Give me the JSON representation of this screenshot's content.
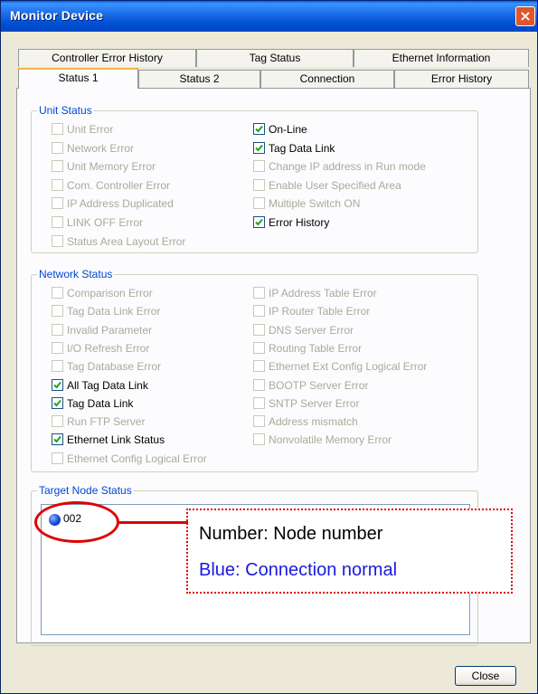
{
  "window": {
    "title": "Monitor Device",
    "close_glyph": "×"
  },
  "tabs_back": [
    "Controller Error History",
    "Tag Status",
    "Ethernet Information"
  ],
  "tabs_front": [
    "Status 1",
    "Status 2",
    "Connection",
    "Error History"
  ],
  "active_tab": "Status 1",
  "unit_status": {
    "label": "Unit Status",
    "left": [
      {
        "label": "Unit Error",
        "checked": false,
        "enabled": false
      },
      {
        "label": "Network Error",
        "checked": false,
        "enabled": false
      },
      {
        "label": "Unit Memory Error",
        "checked": false,
        "enabled": false
      },
      {
        "label": "Com. Controller Error",
        "checked": false,
        "enabled": false
      },
      {
        "label": "IP Address Duplicated",
        "checked": false,
        "enabled": false
      },
      {
        "label": "LINK OFF Error",
        "checked": false,
        "enabled": false
      },
      {
        "label": "Status Area Layout Error",
        "checked": false,
        "enabled": false
      }
    ],
    "right": [
      {
        "label": "On-Line",
        "checked": true,
        "enabled": true
      },
      {
        "label": "Tag Data Link",
        "checked": true,
        "enabled": true
      },
      {
        "label": "Change IP address in Run mode",
        "checked": false,
        "enabled": false
      },
      {
        "label": "Enable User Specified Area",
        "checked": false,
        "enabled": false
      },
      {
        "label": "Multiple Switch ON",
        "checked": false,
        "enabled": false
      },
      {
        "label": "Error History",
        "checked": true,
        "enabled": true
      }
    ]
  },
  "network_status": {
    "label": "Network Status",
    "left": [
      {
        "label": "Comparison Error",
        "checked": false,
        "enabled": false
      },
      {
        "label": "Tag Data Link Error",
        "checked": false,
        "enabled": false
      },
      {
        "label": "Invalid Parameter",
        "checked": false,
        "enabled": false
      },
      {
        "label": "I/O Refresh Error",
        "checked": false,
        "enabled": false
      },
      {
        "label": "Tag Database Error",
        "checked": false,
        "enabled": false
      },
      {
        "label": "All Tag Data Link",
        "checked": true,
        "enabled": true
      },
      {
        "label": "Tag Data Link",
        "checked": true,
        "enabled": true
      },
      {
        "label": "Run FTP Server",
        "checked": false,
        "enabled": false
      },
      {
        "label": "Ethernet Link Status",
        "checked": true,
        "enabled": true
      },
      {
        "label": "Ethernet Config Logical Error",
        "checked": false,
        "enabled": false
      }
    ],
    "right": [
      {
        "label": "IP Address Table Error",
        "checked": false,
        "enabled": false
      },
      {
        "label": "IP Router Table Error",
        "checked": false,
        "enabled": false
      },
      {
        "label": "DNS Server Error",
        "checked": false,
        "enabled": false
      },
      {
        "label": "Routing Table Error",
        "checked": false,
        "enabled": false
      },
      {
        "label": "Ethernet Ext Config Logical Error",
        "checked": false,
        "enabled": false
      },
      {
        "label": "BOOTP Server Error",
        "checked": false,
        "enabled": false
      },
      {
        "label": "SNTP Server Error",
        "checked": false,
        "enabled": false
      },
      {
        "label": "Address mismatch",
        "checked": false,
        "enabled": false
      },
      {
        "label": "Nonvolatile Memory Error",
        "checked": false,
        "enabled": false
      }
    ]
  },
  "target_node_status": {
    "label": "Target Node Status",
    "nodes": [
      {
        "number": "002",
        "color": "#1648d8"
      }
    ]
  },
  "callout": {
    "line1": "Number: Node number",
    "line2": "Blue: Connection normal",
    "line2_color": "#1a1ae0",
    "border_color": "#e00000"
  },
  "buttons": {
    "close": "Close"
  },
  "icons": {
    "check": "check-icon",
    "node": "node-status-icon"
  }
}
